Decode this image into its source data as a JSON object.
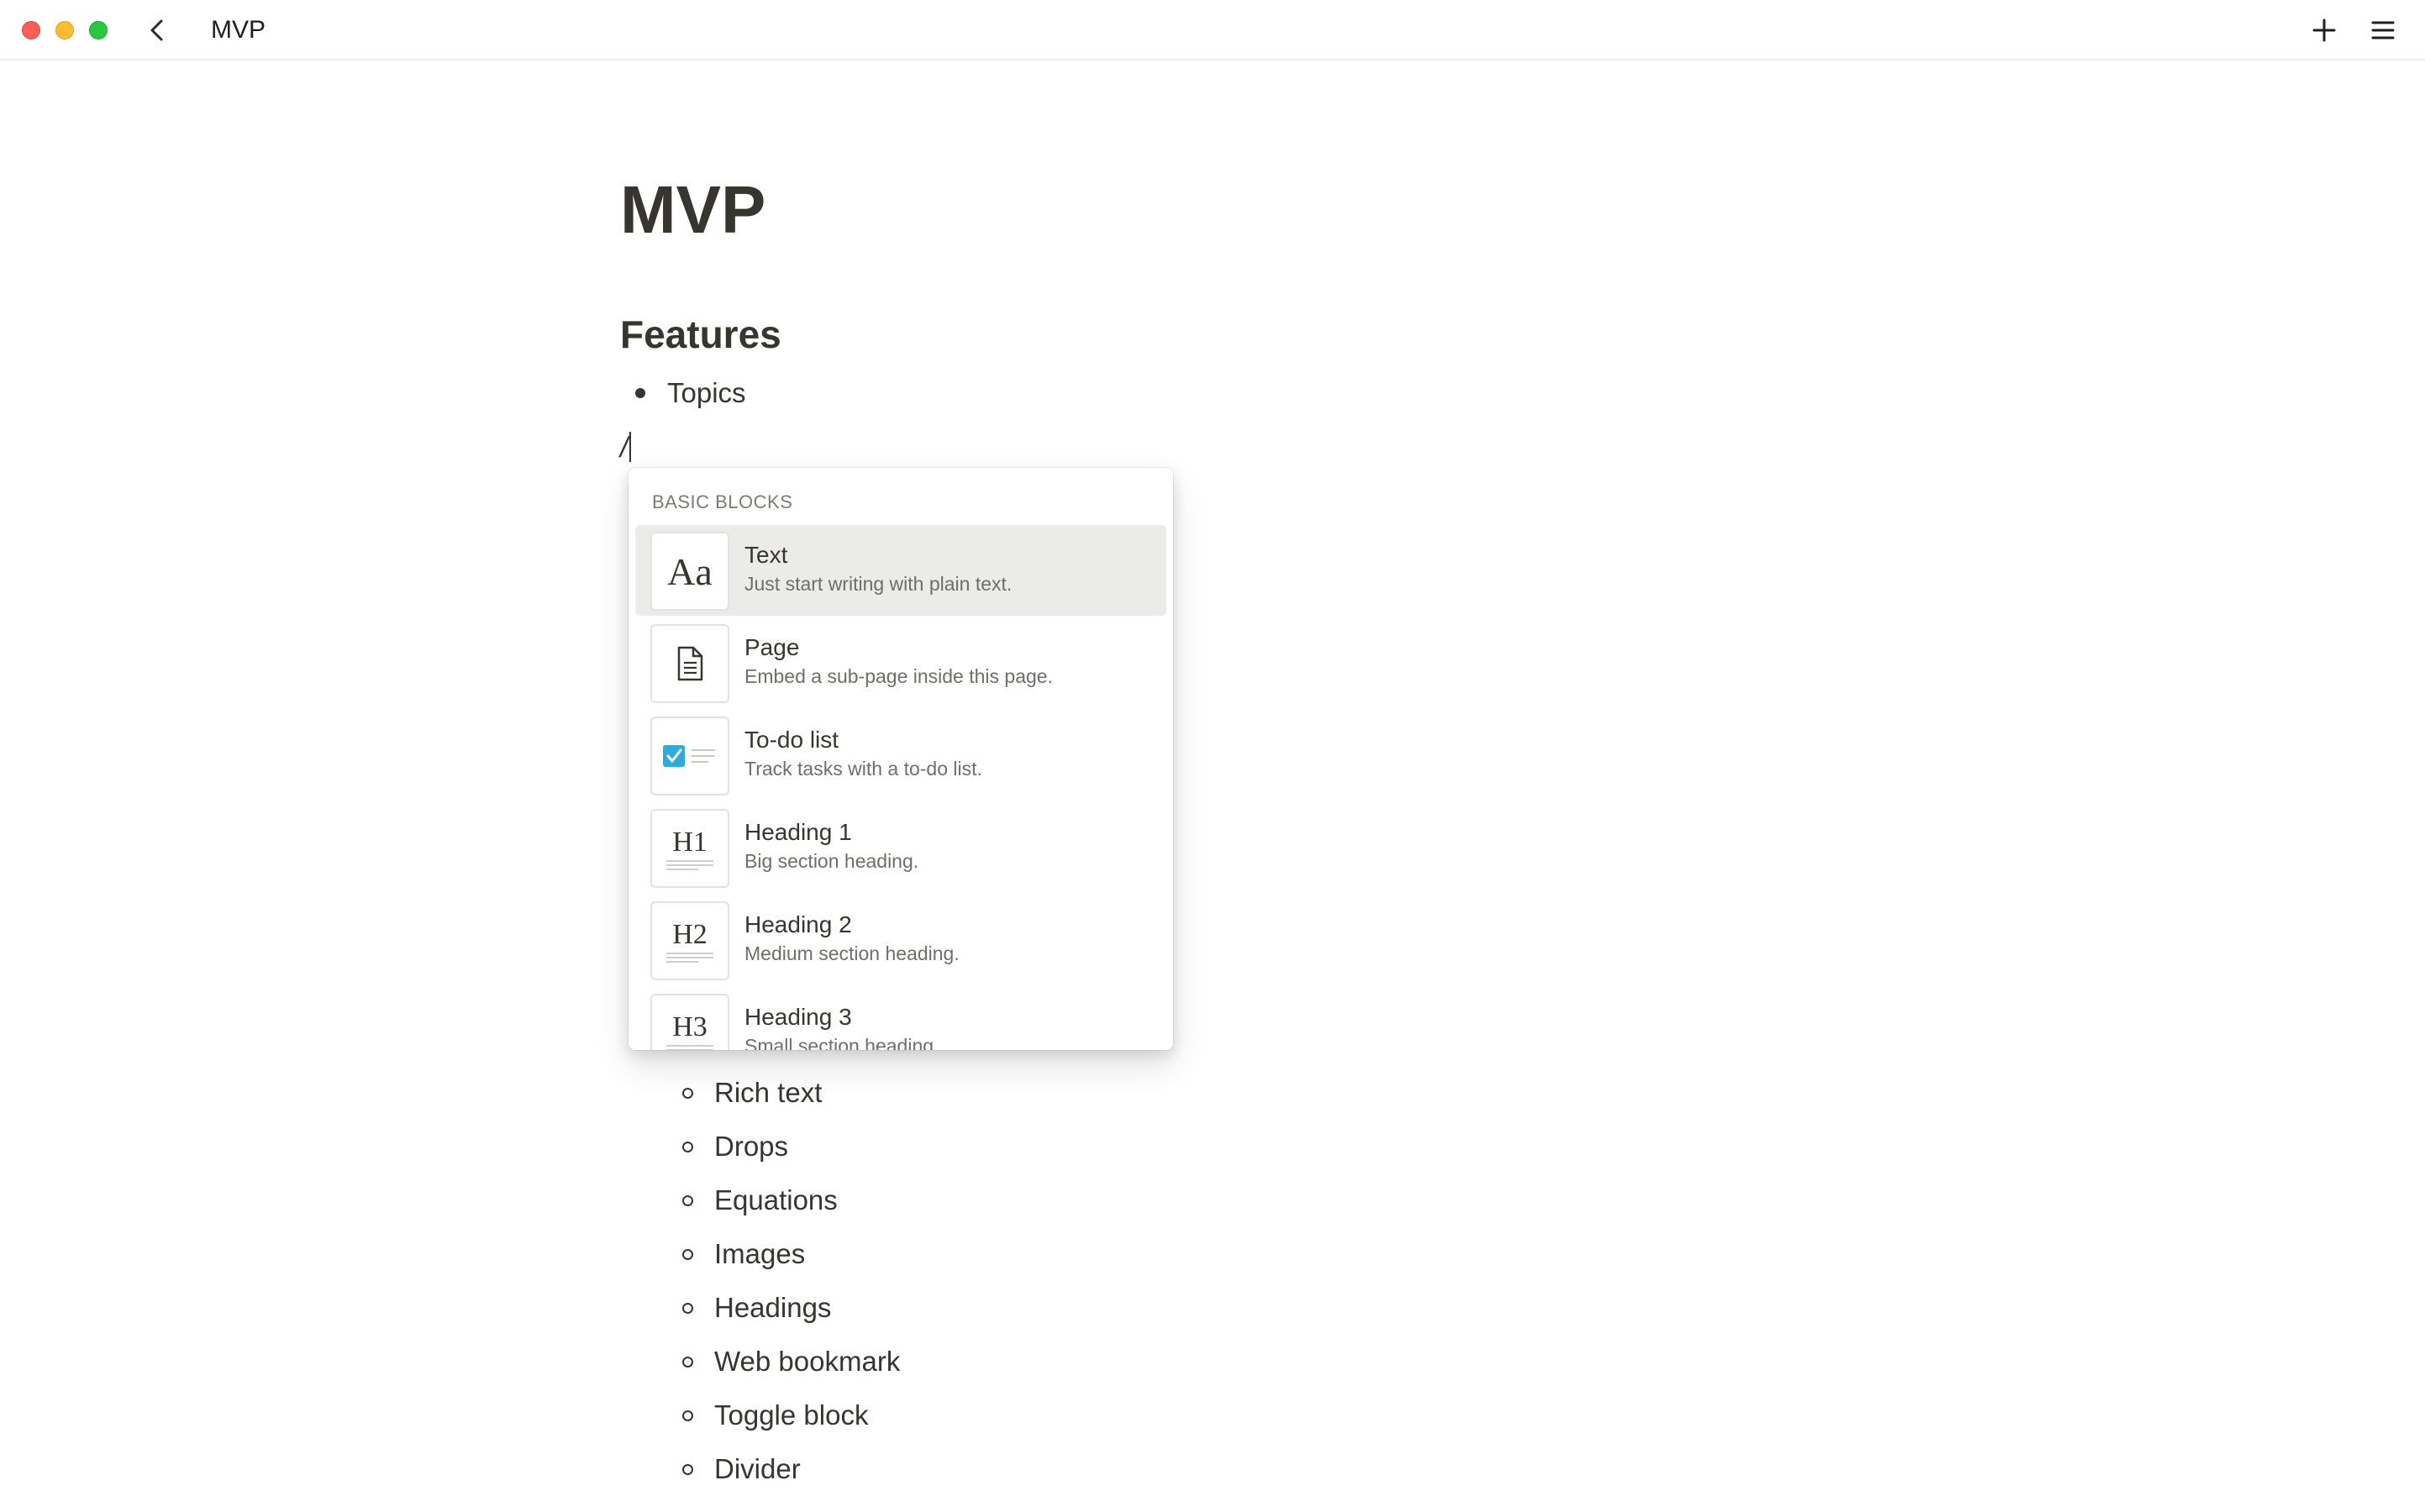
{
  "window": {
    "title": "MVP"
  },
  "document": {
    "title": "MVP",
    "section_heading": "Features",
    "top_bullets": [
      "Topics"
    ],
    "slash_input": "/",
    "sub_bullets": [
      "Rich text",
      "Drops",
      "Equations",
      "Images",
      "Headings",
      "Web bookmark",
      "Toggle block",
      "Divider"
    ]
  },
  "slash_menu": {
    "section_label": "BASIC BLOCKS",
    "items": [
      {
        "title": "Text",
        "description": "Just start writing with plain text.",
        "icon": "text-aa-icon",
        "glyph": "Aa"
      },
      {
        "title": "Page",
        "description": "Embed a sub-page inside this page.",
        "icon": "page-icon",
        "glyph": ""
      },
      {
        "title": "To-do list",
        "description": "Track tasks with a to-do list.",
        "icon": "todo-checkbox-icon",
        "glyph": ""
      },
      {
        "title": "Heading 1",
        "description": "Big section heading.",
        "icon": "heading-1-icon",
        "glyph": "H1"
      },
      {
        "title": "Heading 2",
        "description": "Medium section heading.",
        "icon": "heading-2-icon",
        "glyph": "H2"
      },
      {
        "title": "Heading 3",
        "description": "Small section heading.",
        "icon": "heading-3-icon",
        "glyph": "H3"
      }
    ],
    "selected_index": 0
  },
  "colors": {
    "text": "#37352f",
    "selected_bg": "#ebebea",
    "checkbox_blue": "#2eaadc",
    "traffic_red": "#ff5f57",
    "traffic_yellow": "#febc2e",
    "traffic_green": "#28c840"
  }
}
